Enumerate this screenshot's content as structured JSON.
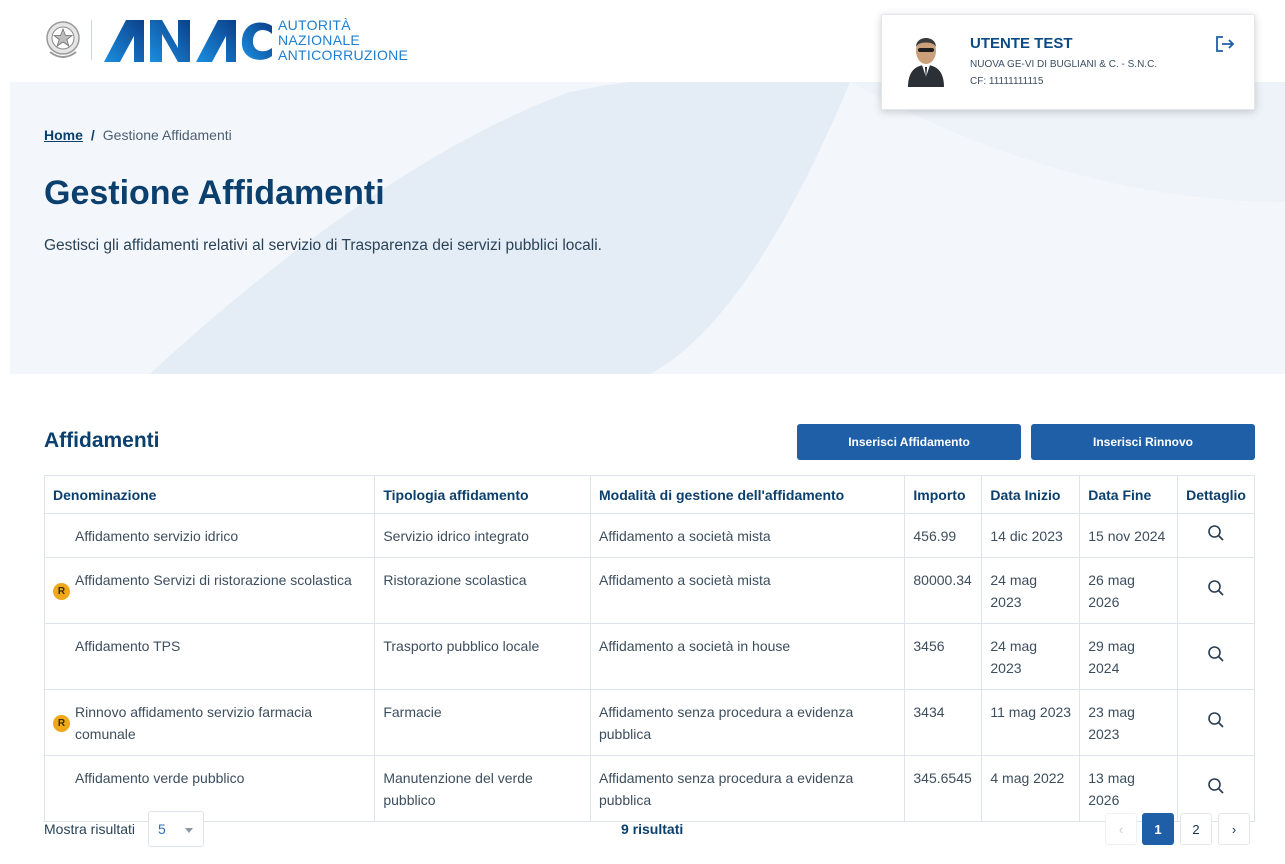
{
  "brand": {
    "line1": "AUTORITÀ",
    "line2": "NAZIONALE",
    "line3": "ANTICORRUZIONE",
    "accent_color": "#1e7fd0",
    "primary_color": "#1f5fa8"
  },
  "user": {
    "name": "UTENTE TEST",
    "company": "NUOVA GE-VI DI BUGLIANI & C. - S.N.C.",
    "cf": "CF: 11111111115",
    "logout_icon": "logout-icon"
  },
  "breadcrumb": {
    "home": "Home",
    "separator": "/",
    "current": "Gestione Affidamenti"
  },
  "page": {
    "title": "Gestione Affidamenti",
    "description": "Gestisci gli affidamenti relativi al servizio di Trasparenza dei servizi pubblici locali."
  },
  "section": {
    "title": "Affidamenti",
    "btn_affidamento": "Inserisci Affidamento",
    "btn_rinnovo": "Inserisci Rinnovo"
  },
  "table": {
    "headers": {
      "denominazione": "Denominazione",
      "tipologia": "Tipologia affidamento",
      "modalita": "Modalità di gestione dell'affidamento",
      "importo": "Importo",
      "data_inizio": "Data Inizio",
      "data_fine": "Data Fine",
      "dettaglio": "Dettaglio"
    },
    "badge_label": "R",
    "badge_color": "#f0a81b",
    "rows": [
      {
        "denominazione": "Affidamento servizio idrico",
        "renewal": false,
        "tipologia": "Servizio idrico integrato",
        "modalita": "Affidamento a società mista",
        "importo": "456.99",
        "data_inizio": "14 dic 2023",
        "data_fine": "15 nov 2024"
      },
      {
        "denominazione": "Affidamento Servizi di ristorazione scolastica",
        "renewal": true,
        "tipologia": "Ristorazione scolastica",
        "modalita": "Affidamento a società mista",
        "importo": "80000.34",
        "data_inizio": "24 mag 2023",
        "data_fine": "26 mag 2026"
      },
      {
        "denominazione": "Affidamento TPS",
        "renewal": false,
        "tipologia": "Trasporto pubblico locale",
        "modalita": "Affidamento a società in house",
        "importo": "3456",
        "data_inizio": "24 mag 2023",
        "data_fine": "29 mag 2024"
      },
      {
        "denominazione": "Rinnovo affidamento servizio farmacia comunale",
        "renewal": true,
        "tipologia": "Farmacie",
        "modalita": "Affidamento senza procedura a evidenza pubblica",
        "importo": "3434",
        "data_inizio": "11 mag 2023",
        "data_fine": "23 mag 2023"
      },
      {
        "denominazione": "Affidamento verde pubblico",
        "renewal": false,
        "tipologia": "Manutenzione del verde pubblico",
        "modalita": "Affidamento senza procedura a evidenza pubblica",
        "importo": "345.6545",
        "data_inizio": "4 mag 2022",
        "data_fine": "13 mag 2026"
      }
    ]
  },
  "footer": {
    "show_label": "Mostra risultati",
    "page_size": "5",
    "results": "9 risultati",
    "pages": [
      "1",
      "2"
    ],
    "current_page": "1",
    "prev_symbol": "‹",
    "next_symbol": "›"
  }
}
